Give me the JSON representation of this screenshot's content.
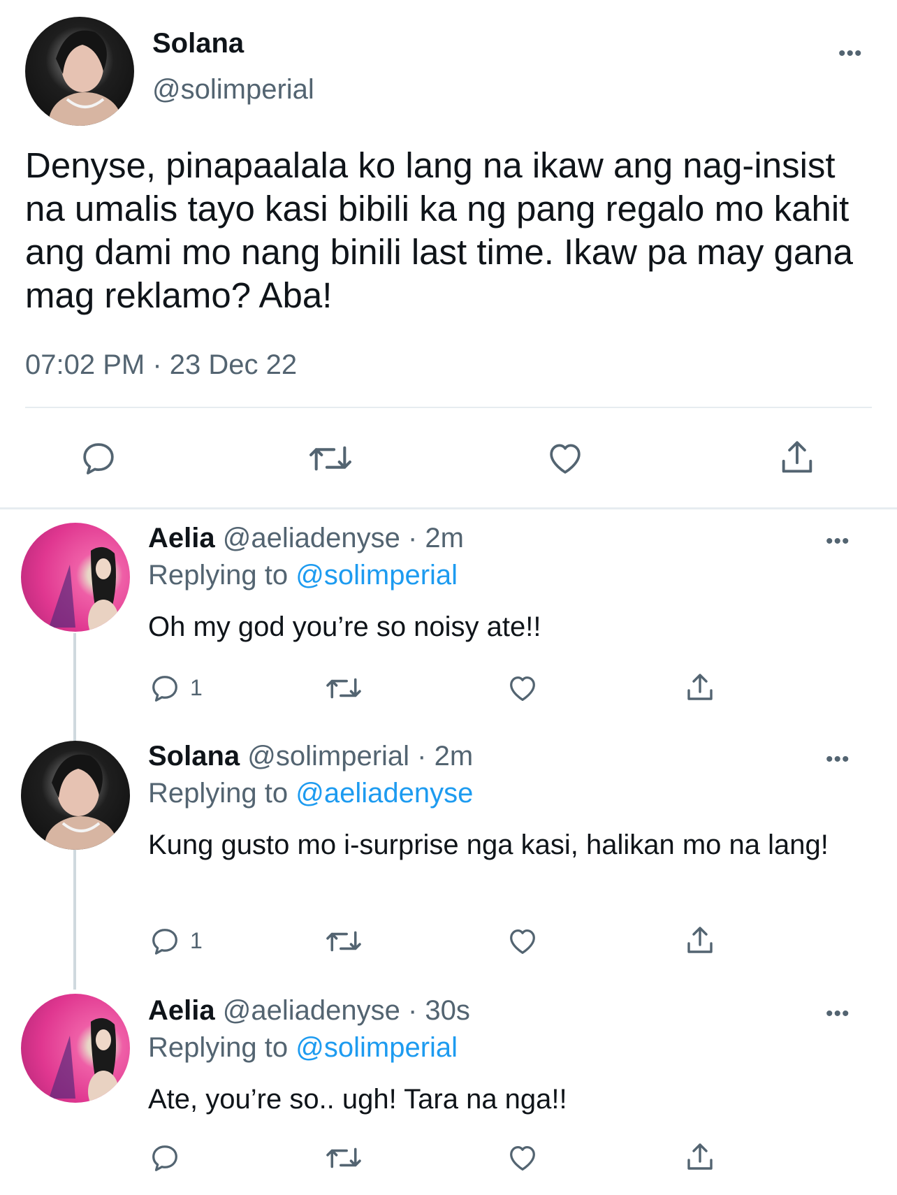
{
  "main_tweet": {
    "author_name": "Solana",
    "author_handle": "@solimperial",
    "text": "Denyse, pinapaalala ko lang na ikaw ang nag-insist na umalis tayo kasi bibili ka ng pang regalo mo kahit ang dami mo nang binili last time. Ikaw pa may gana mag reklamo? Aba!",
    "timestamp": "07:02 PM · 23 Dec 22",
    "more_label": "•••"
  },
  "replies": [
    {
      "author_name": "Aelia",
      "meta": "@aeliadenyse · 2m",
      "replying_prefix": "Replying to",
      "replying_to": "@solimperial",
      "text": "Oh my god you’re so noisy ate!!",
      "reply_count": "1",
      "more_label": "•••"
    },
    {
      "author_name": "Solana",
      "meta": "@solimperial · 2m",
      "replying_prefix": "Replying to",
      "replying_to": "@aeliadenyse",
      "text": "Kung gusto mo i-surprise nga kasi, halikan mo na lang!",
      "reply_count": "1",
      "more_label": "•••"
    },
    {
      "author_name": "Aelia",
      "meta": "@aeliadenyse · 30s",
      "replying_prefix": "Replying to",
      "replying_to": "@solimperial",
      "text": "Ate, you’re so.. ugh! Tara na nga!!",
      "reply_count": "",
      "more_label": "•••"
    }
  ],
  "icons": [
    "reply-icon",
    "retweet-icon",
    "like-icon",
    "share-icon"
  ],
  "colors": {
    "link": "#1d9bf0",
    "muted": "#536471",
    "divider": "#e6ecf0",
    "thread_line": "#cfd9de"
  }
}
